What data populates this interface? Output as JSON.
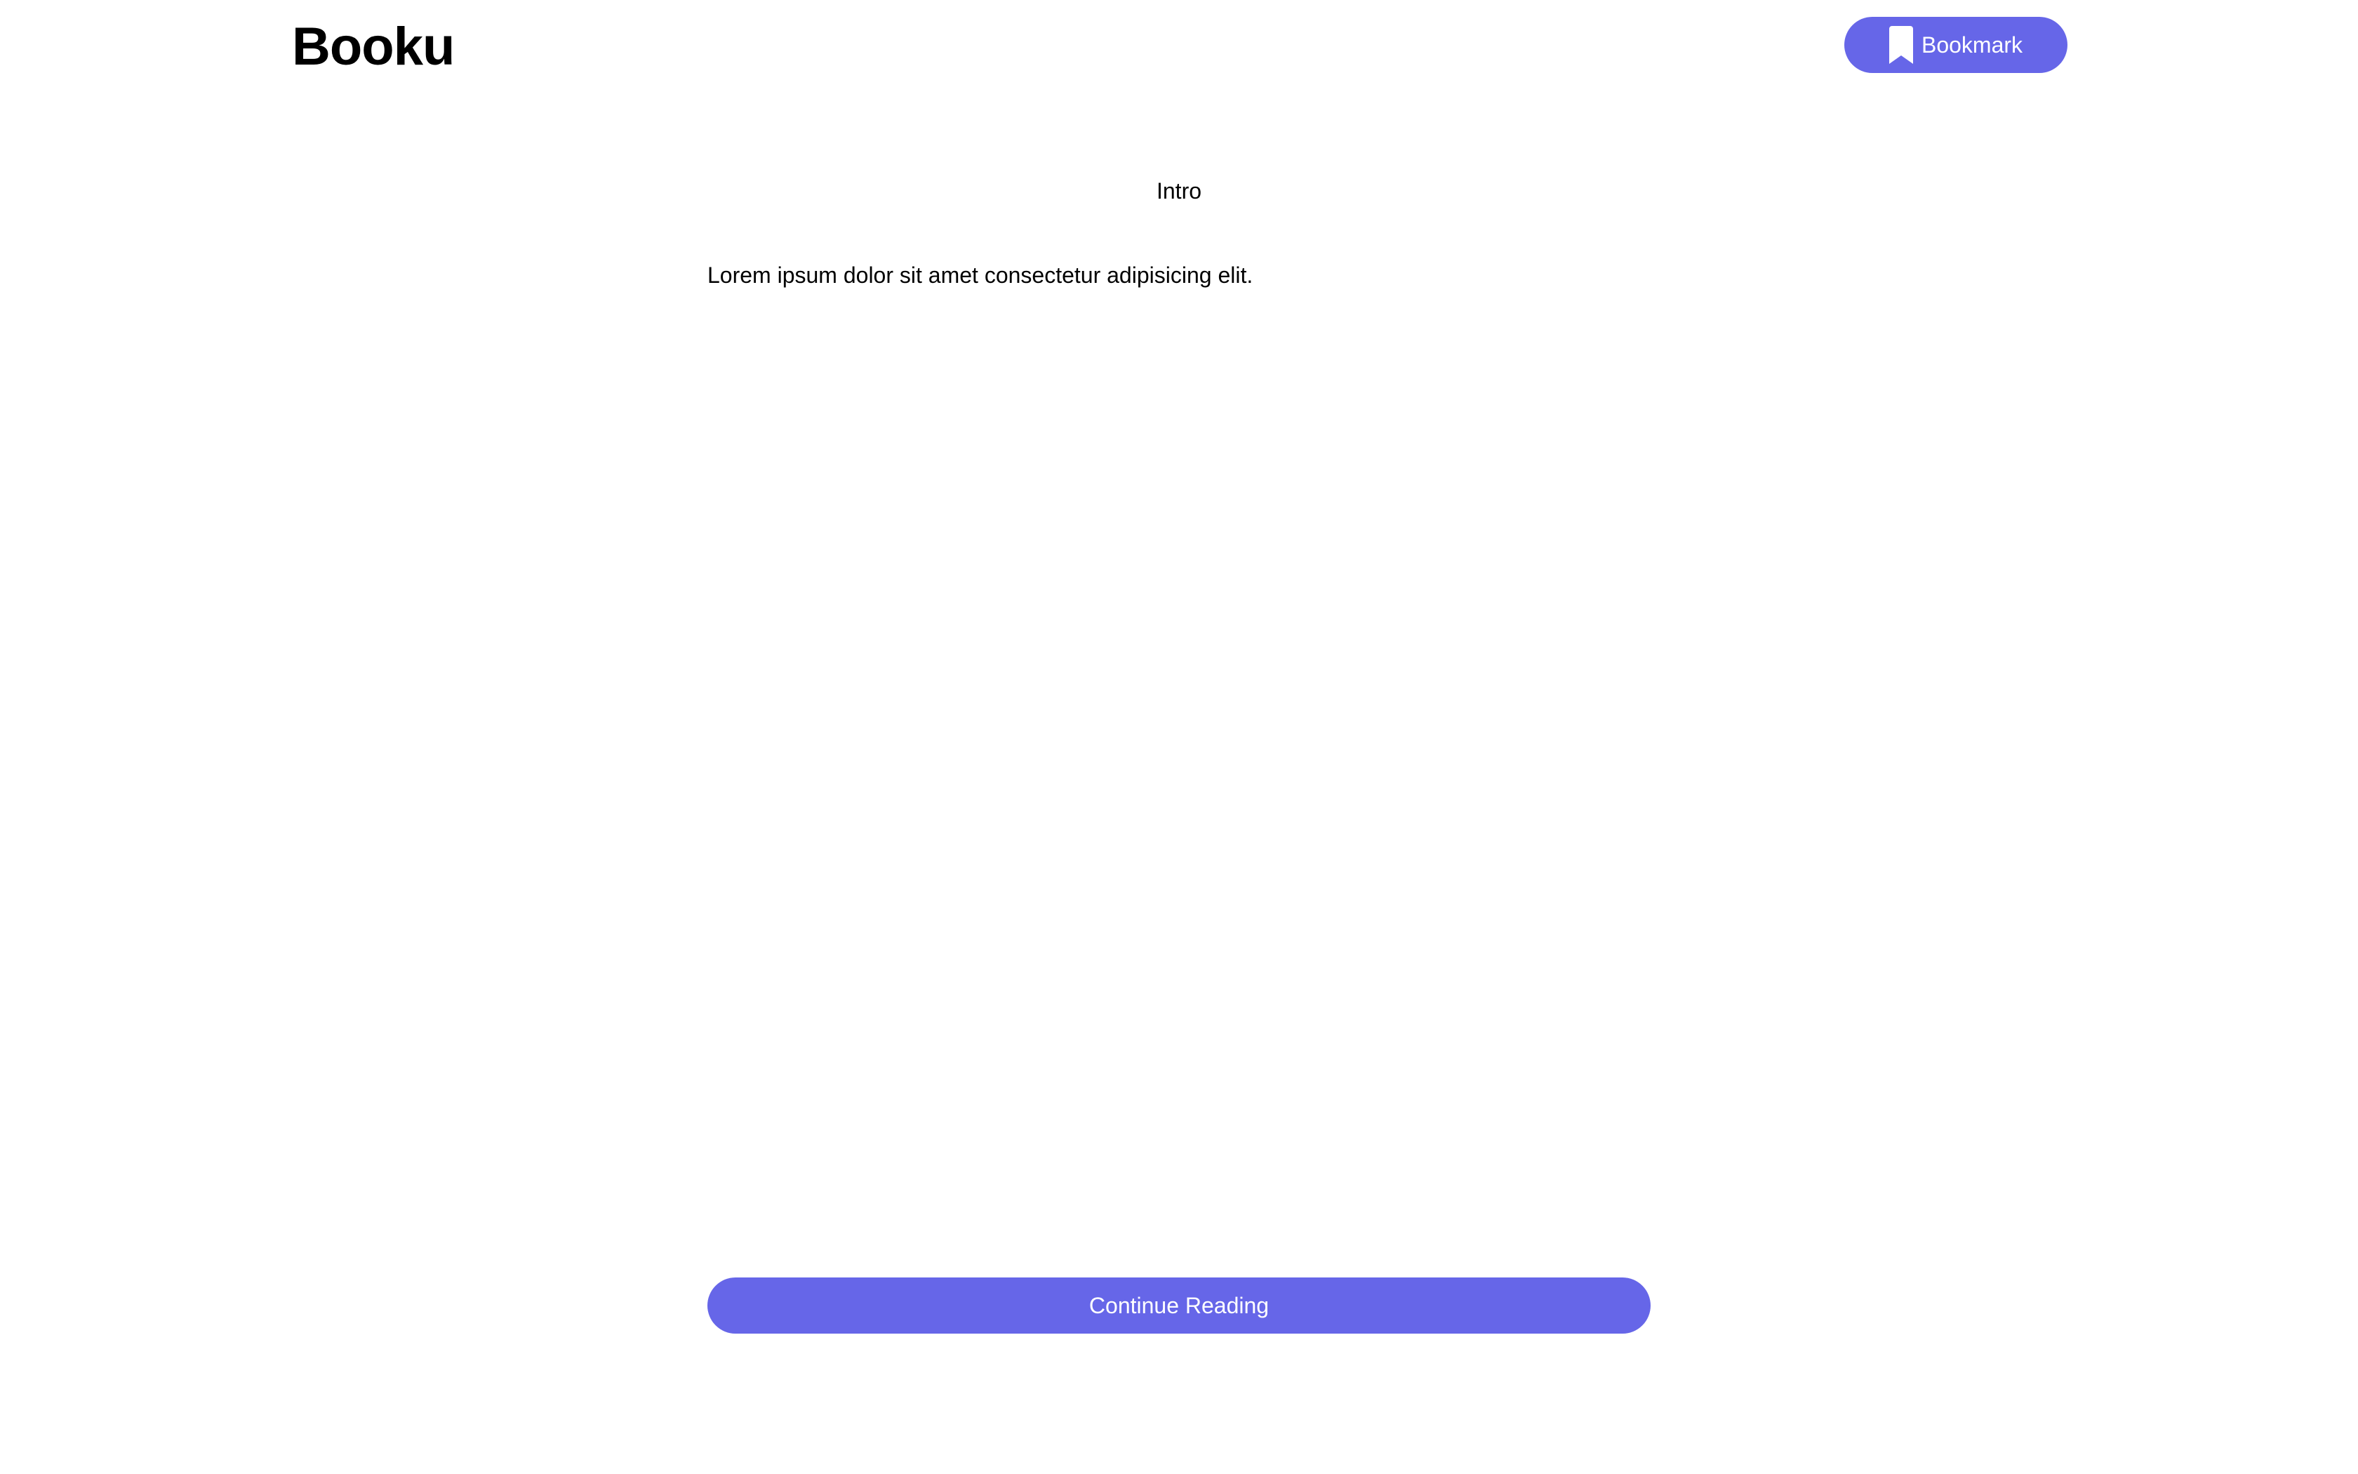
{
  "header": {
    "logo": "Booku",
    "bookmark_label": "Bookmark",
    "bookmark_icon": "bookmark-icon"
  },
  "chapter": {
    "title": "Intro",
    "body": "Lorem ipsum dolor sit amet consectetur adipisicing elit."
  },
  "footer": {
    "continue_label": "Continue Reading"
  },
  "colors": {
    "accent": "#6666e8",
    "background": "#ffffff",
    "text": "#000000"
  }
}
